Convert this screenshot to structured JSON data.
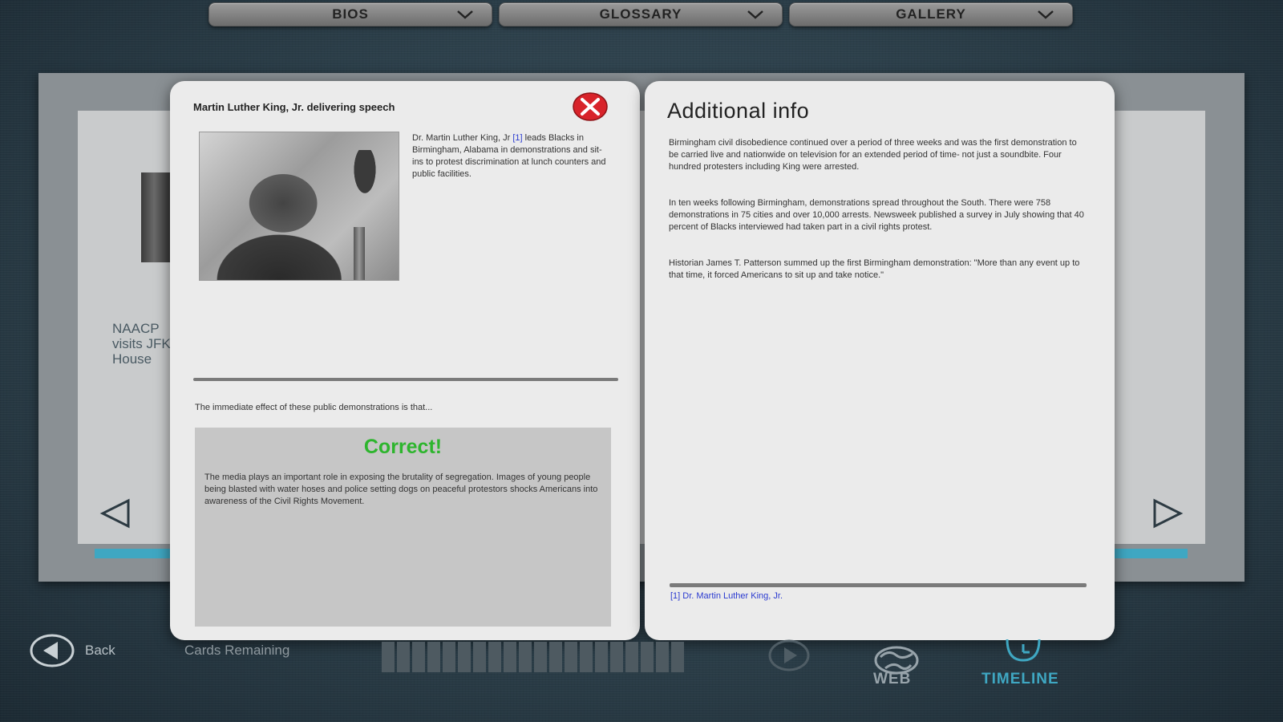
{
  "topnav": {
    "items": [
      {
        "label": "BIOS"
      },
      {
        "label": "GLOSSARY"
      },
      {
        "label": "GALLERY"
      }
    ]
  },
  "deck": {
    "caption": "NAACP visits JFK House"
  },
  "left_card": {
    "title": "Martin Luther King, Jr. delivering speech",
    "intro_before": "Dr. Martin Luther King, Jr ",
    "intro_ref": "[1]",
    "intro_after": " leads Blacks in Birmingham, Alabama in demonstrations and sit-ins to protest discrimination at lunch counters and public facilities.",
    "question": "The immediate effect of these public demonstrations is that...",
    "result": "Correct!",
    "explanation": "The media plays an important role in exposing the brutality of segregation. Images of young people being blasted with water hoses and police setting dogs on peaceful protestors shocks Americans into awareness of the Civil Rights Movement."
  },
  "right_card": {
    "title": "Additional info",
    "paragraphs": [
      "Birmingham civil disobedience continued over a period of three weeks and was the first demonstration to be carried live and nationwide on television for an extended period of time- not just a soundbite. Four hundred protesters including King were arrested.",
      "In ten weeks following Birmingham, demonstrations spread throughout the South. There were 758 demonstrations in 75 cities and over 10,000 arrests. Newsweek published a survey in July showing that 40 percent of Blacks interviewed had taken part in a civil rights protest.",
      "Historian James T. Patterson summed up the first Birmingham demonstration: \"More than any event up to that time, it forced Americans to sit up and take notice.\""
    ],
    "footnote": "[1] Dr. Martin Luther King, Jr."
  },
  "bottom": {
    "back_label": "Back",
    "cards_label": "Cards Remaining",
    "cards_remaining": 20,
    "web_label": "WEB",
    "timeline_label": "TIMELINE"
  },
  "colors": {
    "accent": "#3fa7c2",
    "correct": "#2db52d",
    "link": "#2a3ad0",
    "close": "#d8232a"
  }
}
